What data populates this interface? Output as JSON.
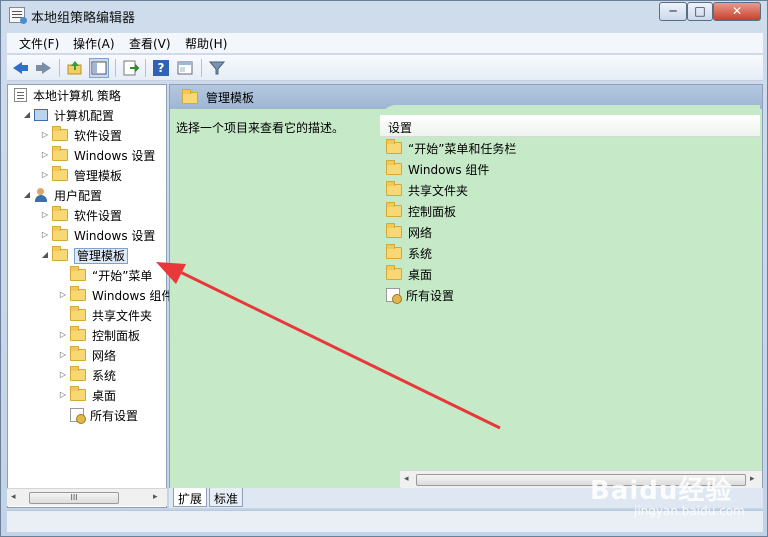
{
  "window": {
    "title": "本地组策略编辑器",
    "min_glyph": "─",
    "max_glyph": "□",
    "close_glyph": "✕"
  },
  "menu": {
    "file": "文件(F)",
    "action": "操作(A)",
    "view": "查看(V)",
    "help": "帮助(H)"
  },
  "toolbar": {
    "help_glyph": "?",
    "filter_glyph": "▼"
  },
  "tree": {
    "root": "本地计算机 策略",
    "computer_config": "计算机配置",
    "comp_software": "软件设置",
    "comp_windows": "Windows 设置",
    "comp_admin": "管理模板",
    "user_config": "用户配置",
    "user_software": "软件设置",
    "user_windows": "Windows 设置",
    "user_admin": "管理模板",
    "children": {
      "start": "“开始”菜单",
      "components": "Windows 组件",
      "shared": "共享文件夹",
      "control": "控制面板",
      "network": "网络",
      "system": "系统",
      "desktop": "桌面",
      "all": "所有设置"
    },
    "expanded_glyph": "◢",
    "collapsed_glyph": "▷"
  },
  "scroll": {
    "left_glyph": "◂",
    "right_glyph": "▸",
    "grip": "III"
  },
  "right": {
    "header": "管理模板",
    "description": "选择一个项目来查看它的描述。",
    "column": "设置",
    "items": [
      "“开始”菜单和任务栏",
      "Windows 组件",
      "共享文件夹",
      "控制面板",
      "网络",
      "系统",
      "桌面",
      "所有设置"
    ]
  },
  "tabs": {
    "extended": "扩展",
    "standard": "标准"
  },
  "watermark": {
    "brand": "Baidu经验",
    "url": "jingyan.baidu.com"
  },
  "colors": {
    "annotation_arrow": "#e8383a",
    "right_pane_bg": "#c6e9c8"
  }
}
